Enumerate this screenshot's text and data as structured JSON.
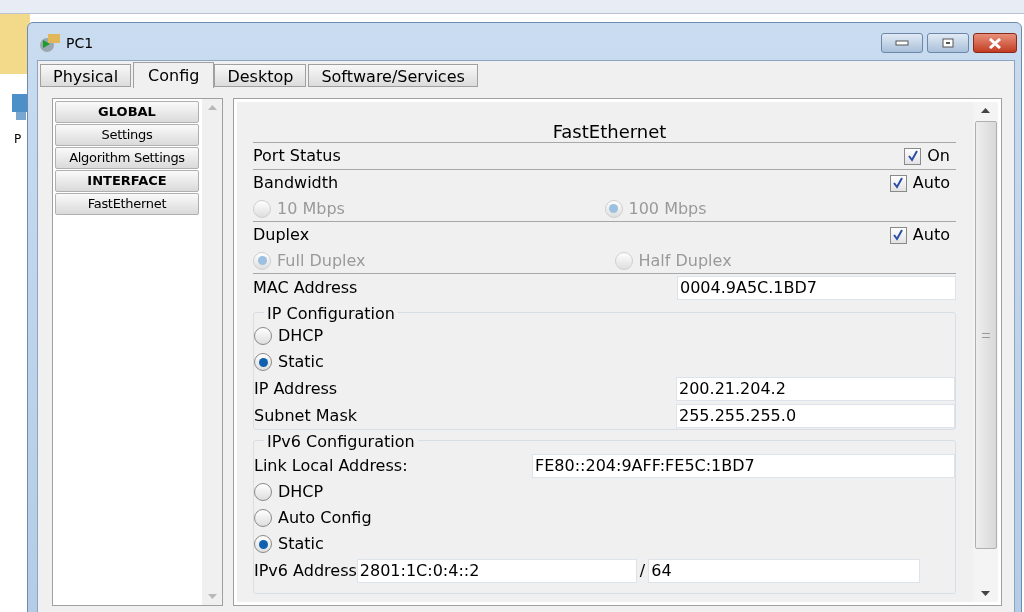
{
  "desktop": {
    "partial_label": "P"
  },
  "window": {
    "title": "PC1"
  },
  "tabs": [
    {
      "label": "Physical",
      "selected": false
    },
    {
      "label": "Config",
      "selected": true
    },
    {
      "label": "Desktop",
      "selected": false
    },
    {
      "label": "Software/Services",
      "selected": false
    }
  ],
  "sidebar": {
    "items": [
      {
        "label": "GLOBAL",
        "kind": "header"
      },
      {
        "label": "Settings",
        "kind": "item"
      },
      {
        "label": "Algorithm Settings",
        "kind": "item"
      },
      {
        "label": "INTERFACE",
        "kind": "header"
      },
      {
        "label": "FastEthernet",
        "kind": "item"
      }
    ]
  },
  "panel": {
    "title": "FastEthernet",
    "port_status": {
      "label": "Port Status",
      "checkbox": {
        "label": "On",
        "checked": true
      }
    },
    "bandwidth": {
      "label": "Bandwidth",
      "auto": {
        "label": "Auto",
        "checked": true
      },
      "options": [
        {
          "label": "10 Mbps",
          "selected": false,
          "disabled": true
        },
        {
          "label": "100 Mbps",
          "selected": true,
          "disabled": true
        }
      ]
    },
    "duplex": {
      "label": "Duplex",
      "auto": {
        "label": "Auto",
        "checked": true
      },
      "options": [
        {
          "label": "Full Duplex",
          "selected": true,
          "disabled": true
        },
        {
          "label": "Half Duplex",
          "selected": false,
          "disabled": true
        }
      ]
    },
    "mac": {
      "label": "MAC Address",
      "value": "0004.9A5C.1BD7"
    },
    "ip_config": {
      "title": "IP Configuration",
      "modes": [
        {
          "label": "DHCP",
          "selected": false
        },
        {
          "label": "Static",
          "selected": true
        }
      ],
      "fields": [
        {
          "label": "IP Address",
          "value": "200.21.204.2"
        },
        {
          "label": "Subnet Mask",
          "value": "255.255.255.0"
        }
      ]
    },
    "ipv6_config": {
      "title": "IPv6 Configuration",
      "link_local": {
        "label": "Link Local Address:",
        "value": "FE80::204:9AFF:FE5C:1BD7"
      },
      "modes": [
        {
          "label": "DHCP",
          "selected": false
        },
        {
          "label": "Auto Config",
          "selected": false
        },
        {
          "label": "Static",
          "selected": true
        }
      ],
      "address": {
        "label": "IPv6 Address",
        "value": "2801:1C:0:4::2",
        "separator": "/",
        "prefix": "64"
      }
    }
  }
}
